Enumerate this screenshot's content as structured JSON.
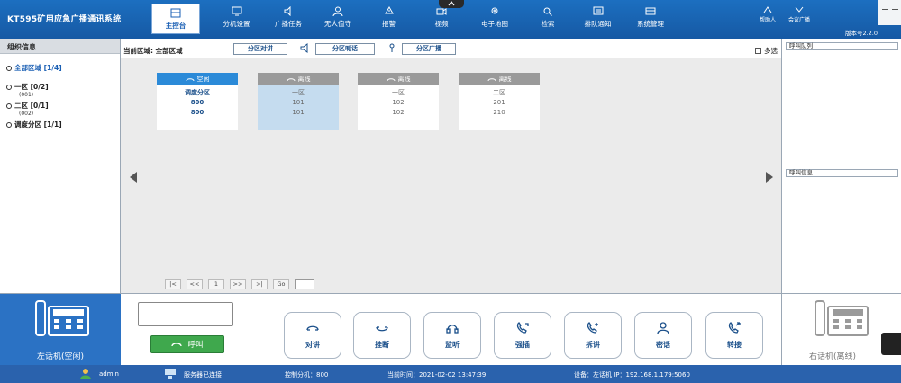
{
  "app": {
    "title": "KT595矿用应急广播通讯系统"
  },
  "nav": {
    "items": [
      {
        "label": "主控台",
        "icon": "console-icon"
      },
      {
        "label": "分机设置",
        "icon": "monitor-icon"
      },
      {
        "label": "广播任务",
        "icon": "broadcast-icon"
      },
      {
        "label": "无人值守",
        "icon": "user-icon"
      },
      {
        "label": "报警",
        "icon": "alarm-icon"
      },
      {
        "label": "视频",
        "icon": "video-icon"
      },
      {
        "label": "电子地图",
        "icon": "map-icon"
      },
      {
        "label": "检索",
        "icon": "search-icon"
      },
      {
        "label": "排队通知",
        "icon": "queue-icon"
      },
      {
        "label": "系统管理",
        "icon": "settings-icon"
      }
    ]
  },
  "top_right": {
    "items": [
      {
        "label": "帮助人"
      },
      {
        "label": "会议广播"
      }
    ],
    "version": "版本号2.2.0"
  },
  "left_panel": {
    "header": "组织信息",
    "tree": [
      {
        "label": "全部区域 [1/4]",
        "sub": ""
      },
      {
        "label": "一区 [0/2]",
        "sub": "(001)"
      },
      {
        "label": "二区 [0/1]",
        "sub": "(002)"
      },
      {
        "label": "调度分区 [1/1]",
        "sub": ""
      }
    ]
  },
  "toolbar": {
    "current_area": "当前区域: 全部区域",
    "btn_intercom": "分区对讲",
    "btn_shout": "分区喊话",
    "btn_broadcast": "分区广播",
    "multi_select": "多选"
  },
  "cards": [
    {
      "status": "空闲",
      "name": "调度分区",
      "line1": "800",
      "line2": "800"
    },
    {
      "status": "离线",
      "name": "一区",
      "line1": "101",
      "line2": "101"
    },
    {
      "status": "离线",
      "name": "一区",
      "line1": "102",
      "line2": "102"
    },
    {
      "status": "离线",
      "name": "二区",
      "line1": "201",
      "line2": "210"
    }
  ],
  "pager": {
    "first": "|<",
    "prev": "<<",
    "page": "1",
    "next": ">>",
    "last": ">|",
    "go": "Go"
  },
  "right_panel": {
    "queue_label": "呼叫队列",
    "info_label": "呼叫信息"
  },
  "bottom": {
    "left_phone_label": "左话机(空闲)",
    "call_button": "呼叫",
    "functions": [
      {
        "label": "对讲",
        "icon": "handset-icon"
      },
      {
        "label": "挂断",
        "icon": "hangup-icon"
      },
      {
        "label": "监听",
        "icon": "headset-icon"
      },
      {
        "label": "强插",
        "icon": "barge-in-icon"
      },
      {
        "label": "拆讲",
        "icon": "split-call-icon"
      },
      {
        "label": "密话",
        "icon": "private-call-icon"
      },
      {
        "label": "转接",
        "icon": "transfer-icon"
      }
    ],
    "right_phone_label": "右话机(离线)"
  },
  "status": {
    "user": "admin",
    "server": "服务器已连接",
    "control_ext": "控制分机：800",
    "time": "当前时间：2021-02-02 13:47:39",
    "device": "设备：左话机  IP：192.168.1.179:5060"
  }
}
